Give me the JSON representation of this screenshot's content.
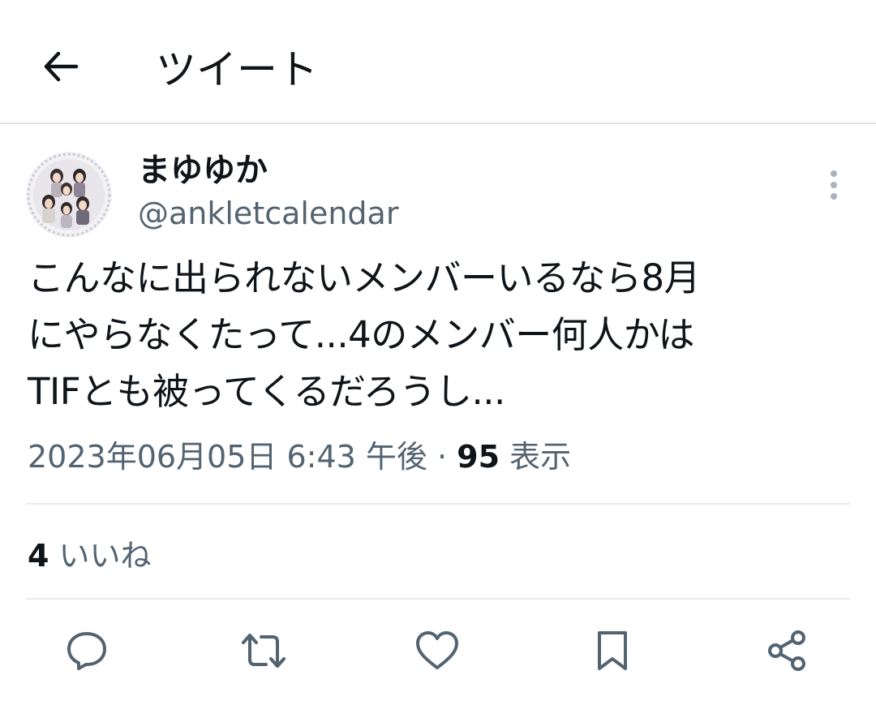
{
  "header": {
    "title": "ツイート",
    "back_icon": "arrow-left-icon"
  },
  "tweet": {
    "author": {
      "display_name": "まゆゆか",
      "handle": "@ankletcalendar",
      "avatar_icon": "avatar-group-photo"
    },
    "more_icon": "more-vertical-icon",
    "text": "こんなに出られないメンバーいるなら8月\nにやらなくたって...4のメンバー何人かは\nTIFとも被ってくるだろうし...",
    "timestamp": "2023年06月05日 6:43 午後",
    "separator": " · ",
    "views_count": "95",
    "views_label": " 表示",
    "likes_count": "4",
    "likes_label": " いいね"
  },
  "actions": [
    {
      "name": "reply",
      "icon": "reply-icon"
    },
    {
      "name": "retweet",
      "icon": "retweet-icon"
    },
    {
      "name": "like",
      "icon": "heart-icon"
    },
    {
      "name": "bookmark",
      "icon": "bookmark-icon"
    },
    {
      "name": "share",
      "icon": "share-icon"
    }
  ],
  "colors": {
    "primary_text": "#0f1419",
    "secondary_text": "#536471",
    "divider": "#e7ebee"
  }
}
